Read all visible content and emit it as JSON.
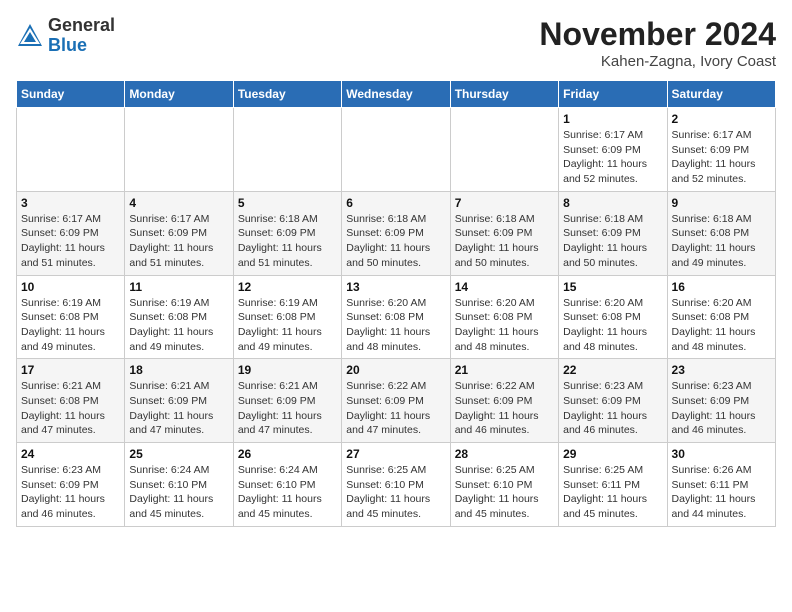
{
  "header": {
    "logo_line1": "General",
    "logo_line2": "Blue",
    "month_year": "November 2024",
    "location": "Kahen-Zagna, Ivory Coast"
  },
  "weekdays": [
    "Sunday",
    "Monday",
    "Tuesday",
    "Wednesday",
    "Thursday",
    "Friday",
    "Saturday"
  ],
  "weeks": [
    [
      {
        "day": "",
        "info": ""
      },
      {
        "day": "",
        "info": ""
      },
      {
        "day": "",
        "info": ""
      },
      {
        "day": "",
        "info": ""
      },
      {
        "day": "",
        "info": ""
      },
      {
        "day": "1",
        "info": "Sunrise: 6:17 AM\nSunset: 6:09 PM\nDaylight: 11 hours and 52 minutes."
      },
      {
        "day": "2",
        "info": "Sunrise: 6:17 AM\nSunset: 6:09 PM\nDaylight: 11 hours and 52 minutes."
      }
    ],
    [
      {
        "day": "3",
        "info": "Sunrise: 6:17 AM\nSunset: 6:09 PM\nDaylight: 11 hours and 51 minutes."
      },
      {
        "day": "4",
        "info": "Sunrise: 6:17 AM\nSunset: 6:09 PM\nDaylight: 11 hours and 51 minutes."
      },
      {
        "day": "5",
        "info": "Sunrise: 6:18 AM\nSunset: 6:09 PM\nDaylight: 11 hours and 51 minutes."
      },
      {
        "day": "6",
        "info": "Sunrise: 6:18 AM\nSunset: 6:09 PM\nDaylight: 11 hours and 50 minutes."
      },
      {
        "day": "7",
        "info": "Sunrise: 6:18 AM\nSunset: 6:09 PM\nDaylight: 11 hours and 50 minutes."
      },
      {
        "day": "8",
        "info": "Sunrise: 6:18 AM\nSunset: 6:09 PM\nDaylight: 11 hours and 50 minutes."
      },
      {
        "day": "9",
        "info": "Sunrise: 6:18 AM\nSunset: 6:08 PM\nDaylight: 11 hours and 49 minutes."
      }
    ],
    [
      {
        "day": "10",
        "info": "Sunrise: 6:19 AM\nSunset: 6:08 PM\nDaylight: 11 hours and 49 minutes."
      },
      {
        "day": "11",
        "info": "Sunrise: 6:19 AM\nSunset: 6:08 PM\nDaylight: 11 hours and 49 minutes."
      },
      {
        "day": "12",
        "info": "Sunrise: 6:19 AM\nSunset: 6:08 PM\nDaylight: 11 hours and 49 minutes."
      },
      {
        "day": "13",
        "info": "Sunrise: 6:20 AM\nSunset: 6:08 PM\nDaylight: 11 hours and 48 minutes."
      },
      {
        "day": "14",
        "info": "Sunrise: 6:20 AM\nSunset: 6:08 PM\nDaylight: 11 hours and 48 minutes."
      },
      {
        "day": "15",
        "info": "Sunrise: 6:20 AM\nSunset: 6:08 PM\nDaylight: 11 hours and 48 minutes."
      },
      {
        "day": "16",
        "info": "Sunrise: 6:20 AM\nSunset: 6:08 PM\nDaylight: 11 hours and 48 minutes."
      }
    ],
    [
      {
        "day": "17",
        "info": "Sunrise: 6:21 AM\nSunset: 6:08 PM\nDaylight: 11 hours and 47 minutes."
      },
      {
        "day": "18",
        "info": "Sunrise: 6:21 AM\nSunset: 6:09 PM\nDaylight: 11 hours and 47 minutes."
      },
      {
        "day": "19",
        "info": "Sunrise: 6:21 AM\nSunset: 6:09 PM\nDaylight: 11 hours and 47 minutes."
      },
      {
        "day": "20",
        "info": "Sunrise: 6:22 AM\nSunset: 6:09 PM\nDaylight: 11 hours and 47 minutes."
      },
      {
        "day": "21",
        "info": "Sunrise: 6:22 AM\nSunset: 6:09 PM\nDaylight: 11 hours and 46 minutes."
      },
      {
        "day": "22",
        "info": "Sunrise: 6:23 AM\nSunset: 6:09 PM\nDaylight: 11 hours and 46 minutes."
      },
      {
        "day": "23",
        "info": "Sunrise: 6:23 AM\nSunset: 6:09 PM\nDaylight: 11 hours and 46 minutes."
      }
    ],
    [
      {
        "day": "24",
        "info": "Sunrise: 6:23 AM\nSunset: 6:09 PM\nDaylight: 11 hours and 46 minutes."
      },
      {
        "day": "25",
        "info": "Sunrise: 6:24 AM\nSunset: 6:10 PM\nDaylight: 11 hours and 45 minutes."
      },
      {
        "day": "26",
        "info": "Sunrise: 6:24 AM\nSunset: 6:10 PM\nDaylight: 11 hours and 45 minutes."
      },
      {
        "day": "27",
        "info": "Sunrise: 6:25 AM\nSunset: 6:10 PM\nDaylight: 11 hours and 45 minutes."
      },
      {
        "day": "28",
        "info": "Sunrise: 6:25 AM\nSunset: 6:10 PM\nDaylight: 11 hours and 45 minutes."
      },
      {
        "day": "29",
        "info": "Sunrise: 6:25 AM\nSunset: 6:11 PM\nDaylight: 11 hours and 45 minutes."
      },
      {
        "day": "30",
        "info": "Sunrise: 6:26 AM\nSunset: 6:11 PM\nDaylight: 11 hours and 44 minutes."
      }
    ]
  ]
}
